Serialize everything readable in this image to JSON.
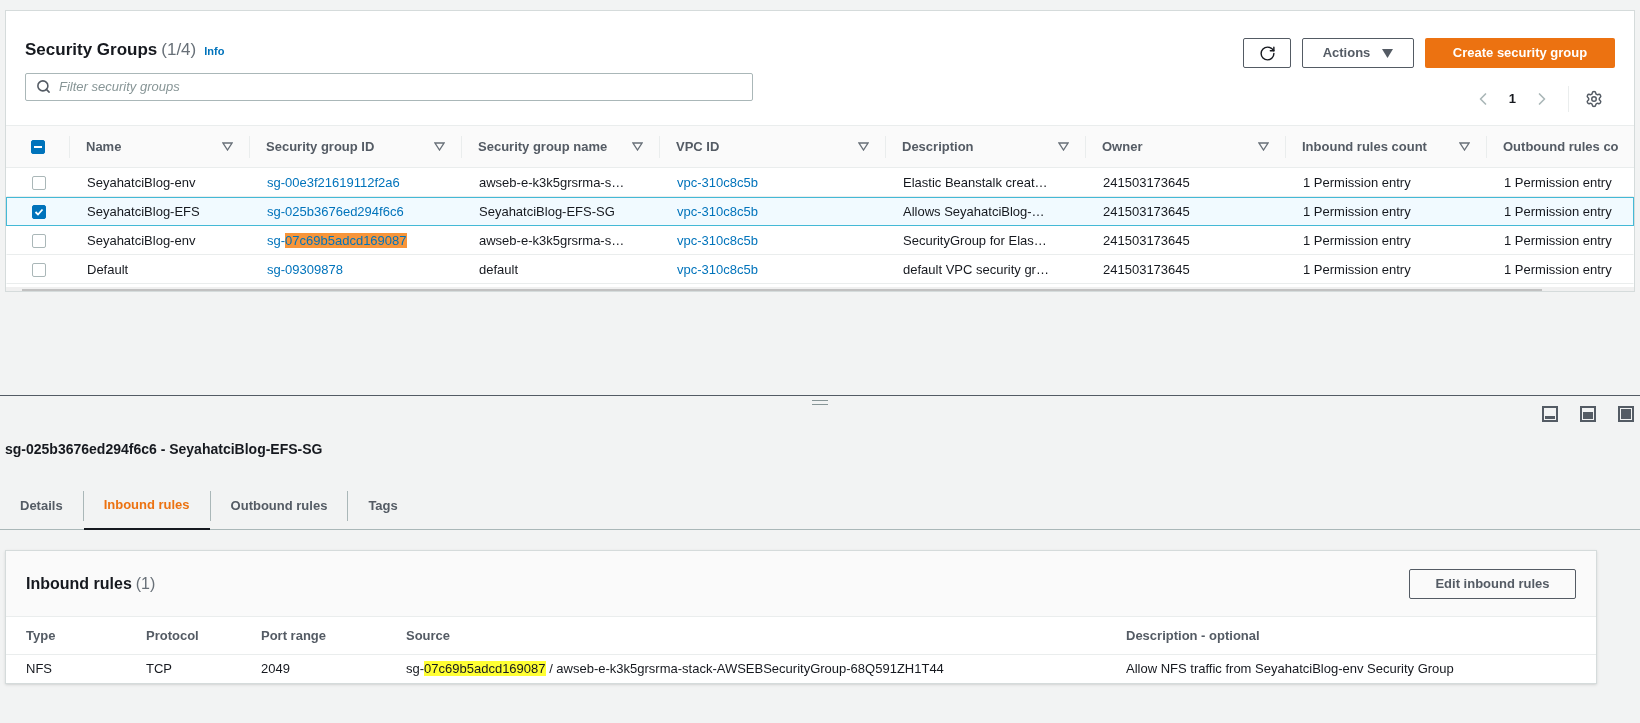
{
  "groups": {
    "title": "Security Groups",
    "count": "(1/4)",
    "info": "Info",
    "buttons": {
      "actions": "Actions",
      "create": "Create security group"
    },
    "filter": {
      "placeholder": "Filter security groups"
    },
    "page": "1",
    "select_all_indeterminate": true,
    "columns": [
      {
        "label": "Name",
        "kind": "text"
      },
      {
        "label": "Security group ID",
        "kind": "link"
      },
      {
        "label": "Security group name",
        "kind": "text"
      },
      {
        "label": "VPC ID",
        "kind": "link"
      },
      {
        "label": "Description",
        "kind": "text"
      },
      {
        "label": "Owner",
        "kind": "text"
      },
      {
        "label": "Inbound rules count",
        "kind": "text"
      },
      {
        "label": "Outbound rules co",
        "kind": "text"
      }
    ],
    "rows": [
      {
        "selected": false,
        "cells": [
          [
            {
              "text": "SeyahatciBlog-env"
            }
          ],
          [
            {
              "text": "sg-00e3f21619112f2a6"
            }
          ],
          [
            {
              "text": "awseb-e-k3k5grsrma-s…"
            }
          ],
          [
            {
              "text": "vpc-310c8c5b"
            }
          ],
          [
            {
              "text": "Elastic Beanstalk creat…"
            }
          ],
          [
            {
              "text": "241503173645"
            }
          ],
          [
            {
              "text": "1 Permission entry"
            }
          ],
          [
            {
              "text": "1 Permission entry"
            }
          ]
        ]
      },
      {
        "selected": true,
        "cells": [
          [
            {
              "text": "SeyahatciBlog-EFS"
            }
          ],
          [
            {
              "text": "sg-025b3676ed294f6c6"
            }
          ],
          [
            {
              "text": "SeyahatciBlog-EFS-SG"
            }
          ],
          [
            {
              "text": "vpc-310c8c5b"
            }
          ],
          [
            {
              "text": "Allows SeyahatciBlog-…"
            }
          ],
          [
            {
              "text": "241503173645"
            }
          ],
          [
            {
              "text": "1 Permission entry"
            }
          ],
          [
            {
              "text": "1 Permission entry"
            }
          ]
        ]
      },
      {
        "selected": false,
        "cells": [
          [
            {
              "text": "SeyahatciBlog-env"
            }
          ],
          [
            {
              "text": "sg-"
            },
            {
              "text": "07c69b5adcd169087",
              "color": "#f7953a"
            }
          ],
          [
            {
              "text": "awseb-e-k3k5grsrma-s…"
            }
          ],
          [
            {
              "text": "vpc-310c8c5b"
            }
          ],
          [
            {
              "text": "SecurityGroup for Elas…"
            }
          ],
          [
            {
              "text": "241503173645"
            }
          ],
          [
            {
              "text": "1 Permission entry"
            }
          ],
          [
            {
              "text": "1 Permission entry"
            }
          ]
        ]
      },
      {
        "selected": false,
        "cells": [
          [
            {
              "text": "Default"
            }
          ],
          [
            {
              "text": "sg-09309878"
            }
          ],
          [
            {
              "text": "default"
            }
          ],
          [
            {
              "text": "vpc-310c8c5b"
            }
          ],
          [
            {
              "text": "default VPC security gr…"
            }
          ],
          [
            {
              "text": "241503173645"
            }
          ],
          [
            {
              "text": "1 Permission entry"
            }
          ],
          [
            {
              "text": "1 Permission entry"
            }
          ]
        ]
      }
    ]
  },
  "details": {
    "title": "sg-025b3676ed294f6c6 - SeyahatciBlog-EFS-SG",
    "tabs": [
      {
        "label": "Details",
        "selected": false
      },
      {
        "label": "Inbound rules",
        "selected": true
      },
      {
        "label": "Outbound rules",
        "selected": false
      },
      {
        "label": "Tags",
        "selected": false
      }
    ],
    "rules": {
      "title": "Inbound rules",
      "count": "(1)",
      "edit": "Edit inbound rules",
      "columns": [
        "Type",
        "Protocol",
        "Port range",
        "Source",
        "Description - optional"
      ],
      "rows": [
        {
          "cells": [
            [
              {
                "text": "NFS"
              }
            ],
            [
              {
                "text": "TCP"
              }
            ],
            [
              {
                "text": "2049"
              }
            ],
            [
              {
                "text": "sg-"
              },
              {
                "text": "07c69b5adcd169087",
                "color": "#ffff33"
              },
              {
                "text": " / awseb-e-k3k5grsrma-stack-AWSEBSecurityGroup-68Q591ZH1T44"
              }
            ],
            [
              {
                "text": "Allow NFS traffic from SeyahatciBlog-env Security Group"
              }
            ]
          ]
        }
      ]
    }
  }
}
